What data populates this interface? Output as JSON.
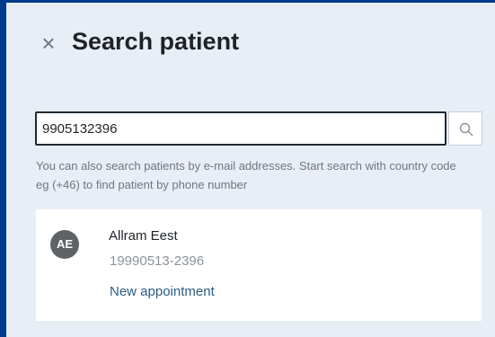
{
  "header": {
    "close_glyph": "×",
    "title": "Search patient"
  },
  "search": {
    "value": "9905132396",
    "hint": "You can also search patients by e-mail addresses. Start search with country code eg (+46) to find patient by phone number"
  },
  "results": [
    {
      "initials": "AE",
      "name": "Allram Eest",
      "personal_number": "19990513-2396",
      "action_label": "New appointment"
    }
  ],
  "icons": {
    "close": "close-icon",
    "search": "search-icon"
  }
}
